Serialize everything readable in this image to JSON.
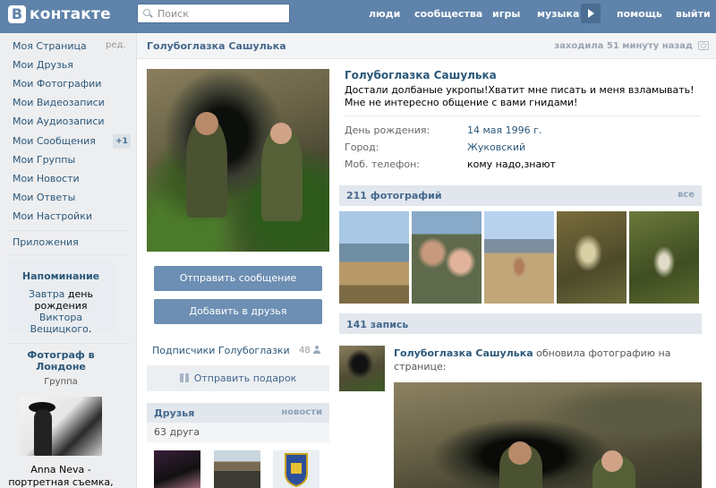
{
  "header": {
    "logo_letter": "В",
    "logo_text": "контакте",
    "search_placeholder": "Поиск",
    "nav": [
      "люди",
      "сообщества",
      "игры",
      "музыка",
      "помощь",
      "выйти"
    ]
  },
  "sidebar": {
    "items": [
      {
        "label": "Моя Страница"
      },
      {
        "label": "Мои Друзья"
      },
      {
        "label": "Мои Фотографии"
      },
      {
        "label": "Мои Видеозаписи"
      },
      {
        "label": "Мои Аудиозаписи"
      },
      {
        "label": "Мои Сообщения"
      },
      {
        "label": "Мои Группы"
      },
      {
        "label": "Мои Новости"
      },
      {
        "label": "Мои Ответы"
      },
      {
        "label": "Мои Настройки"
      }
    ],
    "edit_label": "ред.",
    "messages_badge": "+1",
    "apps_label": "Приложения"
  },
  "reminder": {
    "title": "Напоминание",
    "link1": "Завтра",
    "text1": " день рождения ",
    "link2": "Виктора Вещицкого",
    "text2": "."
  },
  "ad": {
    "title": "Фотограф в Лондоне",
    "subtitle": "Группа",
    "text": "Anna Neva - портретная съемка,"
  },
  "profile": {
    "title_name": "Голубоглазка Сашулька",
    "last_seen": "заходила 51 минуту назад",
    "name": "Голубоглазка Сашулька",
    "status": "Достали долбаные укропы!Хватит мне писать и меня взламывать!Мне не интересно общение с вами гнидами!",
    "fields": [
      {
        "label": "День рождения:",
        "value": "14 мая 1996 г."
      },
      {
        "label": "Город:",
        "value": "Жуковский"
      },
      {
        "label": "Моб. телефон:",
        "value": "кому надо,знают"
      }
    ],
    "send_message": "Отправить сообщение",
    "add_friend": "Добавить в друзья",
    "subscribers_label": "Подписчики Голубоглазки",
    "subscribers_count": "48",
    "gift_label": "Отправить подарок",
    "friends_title": "Друзья",
    "friends_news": "новости",
    "friends_count": "63 друга"
  },
  "photos": {
    "title": "211 фотографий",
    "all_label": "все"
  },
  "wall": {
    "title": "141 запись",
    "post_author": "Голубоглазка Сашулька",
    "post_action": "обновила фотографию на странице:"
  },
  "colors": {
    "header_bg": "#5f83aa",
    "link": "#2b587a",
    "button_bg": "#6d8fb3",
    "page_bg": "#edeef0"
  }
}
